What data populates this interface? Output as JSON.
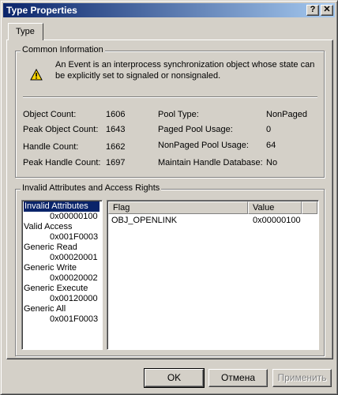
{
  "window": {
    "title": "Type Properties",
    "help_glyph": "?",
    "close_glyph": "✕"
  },
  "tabs": [
    {
      "label": "Type"
    }
  ],
  "common": {
    "group_label": "Common Information",
    "description_line1": "An Event is an interprocess synchronization object whose state can",
    "description_line2": "be explicitly set to signaled or nonsignaled.",
    "stats_left": [
      {
        "label": "Object Count:",
        "value": "1606"
      },
      {
        "label": "Peak Object Count:",
        "value": "1643"
      },
      {
        "label": "Handle Count:",
        "value": "1662"
      },
      {
        "label": "Peak Handle Count:",
        "value": "1697"
      }
    ],
    "stats_right": [
      {
        "label": "Pool Type:",
        "value": "NonPaged"
      },
      {
        "label": "Paged Pool Usage:",
        "value": "0"
      },
      {
        "label": "NonPaged Pool Usage:",
        "value": "64"
      },
      {
        "label": "Maintain Handle Database:",
        "value": "No"
      }
    ]
  },
  "invalid": {
    "group_label": "Invalid Attributes and Access Rights",
    "list": [
      {
        "name": "Invalid Attributes",
        "value": "0x00000100"
      },
      {
        "name": "Valid Access",
        "value": "0x001F0003"
      },
      {
        "name": "Generic Read",
        "value": "0x00020001"
      },
      {
        "name": "Generic Write",
        "value": "0x00020002"
      },
      {
        "name": "Generic Execute",
        "value": "0x00120000"
      },
      {
        "name": "Generic All",
        "value": "0x001F0003"
      }
    ],
    "columns": [
      "Flag",
      "Value"
    ],
    "rows": [
      {
        "flag": "OBJ_OPENLINK",
        "value": "0x00000100"
      }
    ]
  },
  "buttons": {
    "ok": "OK",
    "cancel": "Отмена",
    "apply": "Применить"
  }
}
